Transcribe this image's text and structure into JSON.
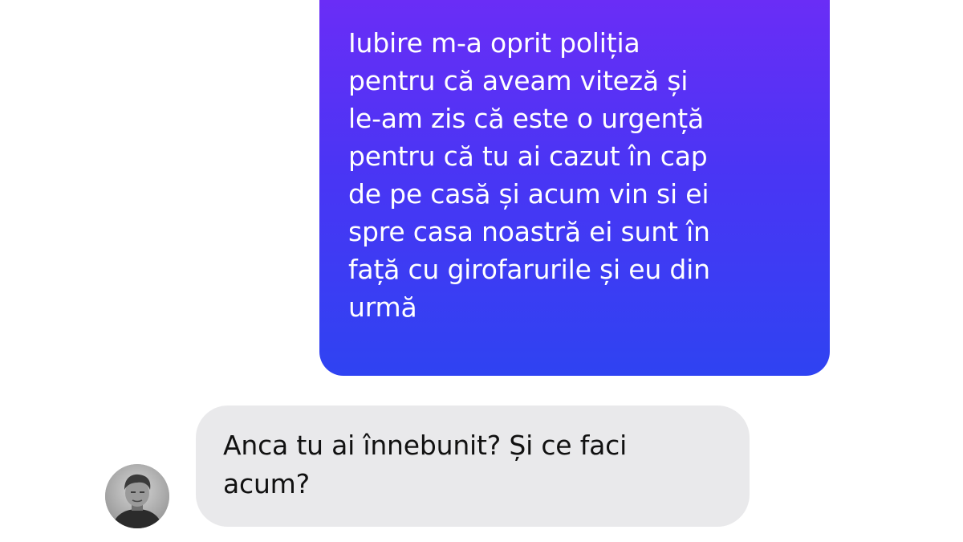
{
  "conversation": {
    "outgoing": {
      "lines": [
        "Iubire m-a oprit poliția",
        "pentru că aveam viteză și",
        "le-am zis că este o urgență",
        "pentru că tu ai cazut în cap",
        "de pe casă și acum vin si ei",
        "spre casa noastră ei sunt în",
        "față cu girofarurile și eu din",
        "urmă"
      ]
    },
    "incoming": {
      "lines": [
        "Anca tu ai înnebunit?  Și ce faci",
        "acum?"
      ]
    }
  },
  "colors": {
    "outgoing_gradient_top": "#6a2df6",
    "outgoing_gradient_bottom": "#2f43f2",
    "incoming_bubble": "#e9e9eb",
    "background": "#ffffff"
  },
  "icons": {
    "avatar": "contact-avatar-photo"
  }
}
